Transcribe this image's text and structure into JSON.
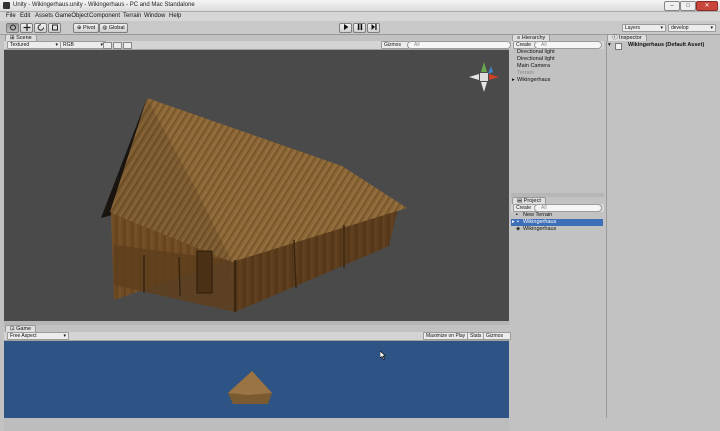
{
  "window": {
    "title": "Unity - Wikingerhaus.unity - Wikingerhaus - PC and Mac Standalone"
  },
  "menu": [
    "File",
    "Edit",
    "Assets",
    "GameObject",
    "Component",
    "Terrain",
    "Window",
    "Help"
  ],
  "toolbar": {
    "pivot_label": "Pivot",
    "global_label": "Global",
    "layers_label": "Layers",
    "layout_label": "develop"
  },
  "scene": {
    "tab_label": "Scene",
    "render_mode": "Textured",
    "color_mode": "RGB",
    "gizmos_label": "Gizmos",
    "search_placeholder": "All"
  },
  "game": {
    "tab_label": "Game",
    "aspect_label": "Free Aspect",
    "maximize_label": "Maximize on Play",
    "stats_label": "Stats",
    "gizmos_label": "Gizmos"
  },
  "hierarchy": {
    "tab_label": "Hierarchy",
    "create_label": "Create",
    "search_placeholder": "All",
    "items": [
      {
        "label": "Directional light",
        "muted": false,
        "foldout": false
      },
      {
        "label": "Directional light",
        "muted": false,
        "foldout": false
      },
      {
        "label": "Main Camera",
        "muted": false,
        "foldout": false
      },
      {
        "label": "Terrain",
        "muted": true,
        "foldout": false
      },
      {
        "label": "Wikingerhaus",
        "muted": false,
        "foldout": true
      }
    ]
  },
  "project": {
    "tab_label": "Project",
    "create_label": "Create",
    "search_placeholder": "All",
    "items": [
      {
        "label": "New Terrain",
        "selected": false,
        "foldout": false
      },
      {
        "label": "Wikingerhaus",
        "selected": true,
        "foldout": true
      },
      {
        "label": "Wikingerhaus",
        "selected": false,
        "foldout": false
      }
    ]
  },
  "inspector": {
    "tab_label": "Inspector",
    "object_title": "Wikingerhaus (Default Asset)"
  },
  "colors": {
    "scene_bg": "#4a4a4a",
    "game_bg": "#2e5485",
    "selection": "#3d6fb8"
  }
}
